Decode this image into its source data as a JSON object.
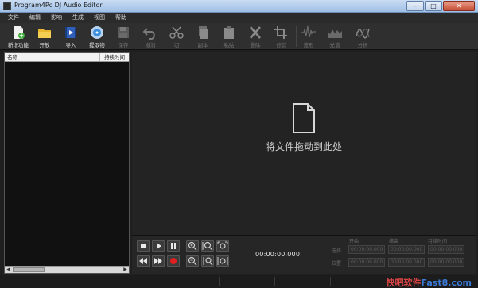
{
  "window": {
    "title": "Program4Pc DJ Audio Editor",
    "controls": [
      "–",
      "□",
      "✕"
    ]
  },
  "menu": [
    "文件",
    "编辑",
    "影响",
    "生成",
    "视图",
    "帮助"
  ],
  "toolbar": [
    {
      "label": "新增功能",
      "icon": "new-file-icon",
      "enabled": true
    },
    {
      "label": "开放",
      "icon": "folder-open-icon",
      "enabled": true
    },
    {
      "label": "导入",
      "icon": "import-film-icon",
      "enabled": true
    },
    {
      "label": "提取物",
      "icon": "disc-extract-icon",
      "enabled": true
    },
    {
      "label": "保存",
      "icon": "save-icon",
      "enabled": false
    },
    {
      "label": "撤消",
      "icon": "undo-icon",
      "enabled": false
    },
    {
      "label": "切",
      "icon": "scissors-icon",
      "enabled": false
    },
    {
      "label": "副本",
      "icon": "copy-icon",
      "enabled": false
    },
    {
      "label": "粘贴",
      "icon": "paste-icon",
      "enabled": false
    },
    {
      "label": "删除",
      "icon": "delete-x-icon",
      "enabled": false
    },
    {
      "label": "修剪",
      "icon": "crop-icon",
      "enabled": false
    },
    {
      "label": "波形",
      "icon": "waveform-icon",
      "enabled": false
    },
    {
      "label": "光谱",
      "icon": "spectrum-icon",
      "enabled": false
    },
    {
      "label": "分析",
      "icon": "analyze-icon",
      "enabled": false
    }
  ],
  "file_list": {
    "col_name": "名称",
    "col_duration": "持续时间"
  },
  "drop_zone": {
    "message": "将文件拖动到此处"
  },
  "transport": {
    "time": "00:00:00.000"
  },
  "selection": {
    "headers": [
      "开始",
      "结束",
      "持续时间"
    ],
    "rows": [
      "选择",
      "位置"
    ],
    "value": "00:00:00.000"
  },
  "watermark": {
    "part1": "快吧软件",
    "part2": "Fast8.com"
  },
  "colors": {
    "record": "#e02020",
    "accent_blue": "#3a8ee0",
    "folder": "#e8b830"
  }
}
